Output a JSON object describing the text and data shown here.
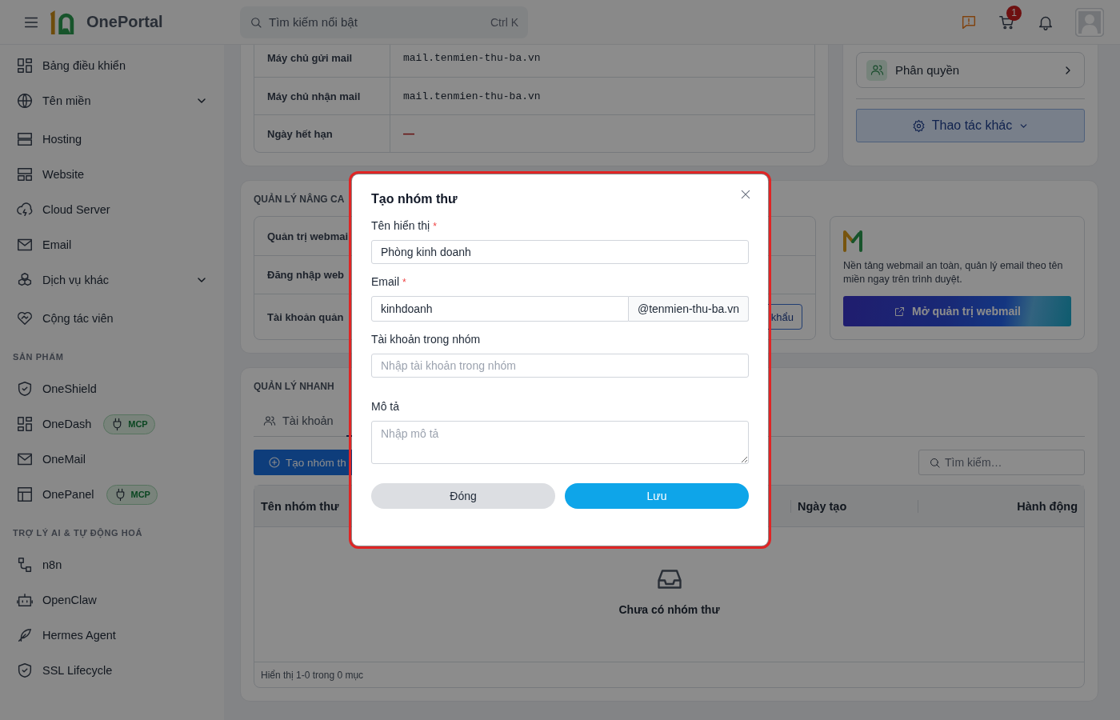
{
  "header": {
    "logo_text": "OnePortal",
    "search": {
      "placeholder": "Tìm kiếm nổi bật",
      "shortcut": "Ctrl K"
    },
    "cart_count": "1"
  },
  "sidebar": {
    "sections": [
      {
        "items": [
          {
            "label": "Bảng điều khiển",
            "kind": "link"
          },
          {
            "label": "Tên miền",
            "kind": "group"
          },
          {
            "label": "Hosting",
            "kind": "link"
          },
          {
            "label": "Website",
            "kind": "link"
          },
          {
            "label": "Cloud Server",
            "kind": "link"
          },
          {
            "label": "Email",
            "kind": "link"
          },
          {
            "label": "Dịch vụ khác",
            "kind": "group"
          },
          {
            "label": "Cộng tác viên",
            "kind": "link"
          }
        ]
      },
      {
        "heading": "SẢN PHẨM",
        "items": [
          {
            "label": "OneShield",
            "kind": "link"
          },
          {
            "label": "OneDash",
            "kind": "link",
            "badge": "MCP"
          },
          {
            "label": "OneMail",
            "kind": "link"
          },
          {
            "label": "OnePanel",
            "kind": "link",
            "badge": "MCP"
          }
        ]
      },
      {
        "heading": "TRỢ LÝ AI & TỰ ĐỘNG HOÁ",
        "items": [
          {
            "label": "n8n",
            "kind": "link"
          },
          {
            "label": "OpenClaw",
            "kind": "link"
          },
          {
            "label": "Hermes Agent",
            "kind": "link"
          },
          {
            "label": "SSL Lifecycle",
            "kind": "link"
          }
        ]
      }
    ]
  },
  "domain_card": {
    "rows": [
      {
        "label": "Máy chủ gửi mail",
        "value": "mail.tenmien-thu-ba.vn",
        "kind": "text"
      },
      {
        "label": "Máy chủ nhận mail",
        "value": "mail.tenmien-thu-ba.vn",
        "kind": "text"
      },
      {
        "label": "Ngày hết hạn",
        "value": "—",
        "kind": "empty"
      }
    ]
  },
  "actions_card": {
    "permission": "Phân quyền",
    "more": "Thao tác khác"
  },
  "advanced": {
    "title": "QUẢN LÝ NÂNG CA",
    "rows": [
      "Quản trị webmai",
      "Đăng nhập web",
      "Tài khoản quản"
    ],
    "row_button": "khẩu",
    "webmail": {
      "description": "Nền tảng webmail an toàn, quản lý email theo tên miền ngay trên trình duyệt.",
      "button": "Mở quản trị webmail"
    }
  },
  "quick": {
    "title": "QUẢN LÝ NHANH",
    "tabs": [
      {
        "label": "Tài khoản",
        "selected": false
      }
    ],
    "create_button": "Tạo nhóm th",
    "search_placeholder": "Tìm kiếm…",
    "columns": [
      "Tên nhóm thư",
      "Ngày tạo",
      "Hành động"
    ],
    "empty_text": "Chưa có nhóm thư",
    "footer": "Hiển thị 1-0 trong 0 mục"
  },
  "modal": {
    "title": "Tạo nhóm thư",
    "fields": [
      {
        "label": "Tên hiển thị",
        "required_mark": "*",
        "kind": "text",
        "value": "Phòng kinh doanh"
      },
      {
        "label": "Email",
        "required_mark": "*",
        "kind": "email",
        "value": "kinhdoanh",
        "suffix": "@tenmien-thu-ba.vn"
      },
      {
        "label": "Tài khoản trong nhóm",
        "kind": "text",
        "placeholder": "Nhập tài khoản trong nhóm"
      },
      {
        "label": "Mô tả",
        "kind": "textarea",
        "placeholder": "Nhập mô tả"
      }
    ],
    "buttons": [
      {
        "label": "Đóng",
        "kind": "secondary"
      },
      {
        "label": "Lưu",
        "kind": "primary"
      }
    ]
  }
}
